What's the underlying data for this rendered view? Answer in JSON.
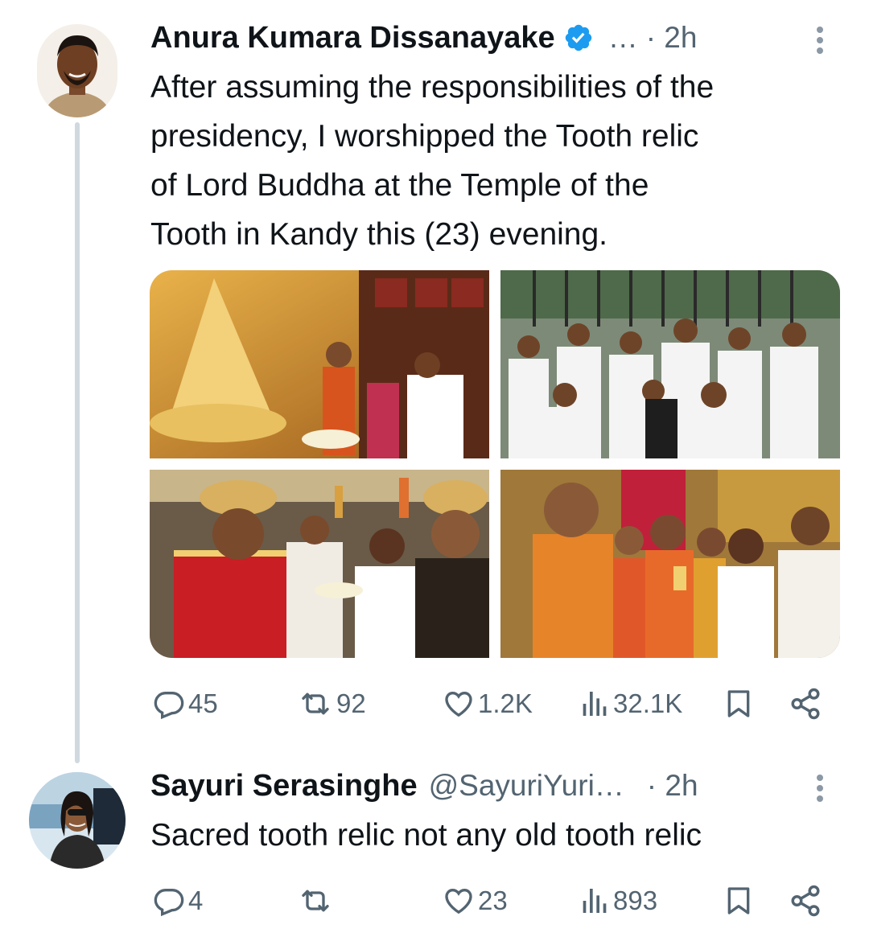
{
  "tweet": {
    "author_name": "Anura Kumara Dissanayake",
    "verified_icon": "verified-badge-icon",
    "handle": "…",
    "time": "· 2h",
    "text_lines": [
      "After assuming the responsibilities of the",
      "presidency, I worshipped the Tooth relic",
      "of Lord Buddha at the Temple of the",
      "Tooth in Kandy this (23) evening."
    ],
    "photos": [
      "tooth-relic-casket-photo",
      "crowd-photo",
      "traditional-attire-photo",
      "monks-photo"
    ],
    "replies": "45",
    "reposts": "92",
    "likes": "1.2K",
    "views": "32.1K"
  },
  "reply": {
    "author_name": "Sayuri Serasinghe",
    "handle": "@SayuriYuri…",
    "time": "· 2h",
    "text": "Sacred tooth relic not any old tooth relic",
    "replies": "4",
    "reposts": "",
    "likes": "23",
    "views": "893"
  },
  "colors": {
    "verified_blue": "#1d9bf0",
    "muted_gray": "#536471",
    "thread_line": "#cfd9de"
  }
}
